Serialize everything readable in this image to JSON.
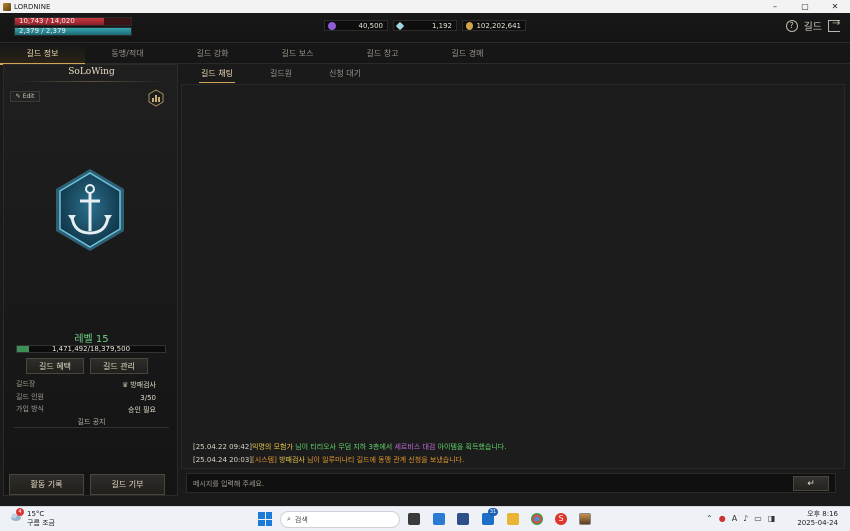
{
  "window": {
    "title": "LORDNINE",
    "min": "–",
    "max": "▢",
    "close": "✕"
  },
  "status": {
    "hp": "10,743 / 14,020",
    "hp_frac": 0.766,
    "mp": "2,379 / 2,379",
    "mp_frac": 1.0
  },
  "currency": [
    {
      "icon": "purple-gem-icon",
      "value": "40,500",
      "color": "#8e5bd6"
    },
    {
      "icon": "diamond-icon",
      "value": "1,192",
      "color": "#9fd6e0"
    },
    {
      "icon": "gold-coin-icon",
      "value": "102,202,641",
      "color": "#d0a24a"
    }
  ],
  "header_right": {
    "help": "?",
    "title": "길드"
  },
  "main_tabs": [
    "길드 정보",
    "동맹/적대",
    "길드 강화",
    "길드 보스",
    "길드 창고",
    "길드 경매"
  ],
  "left": {
    "guild_name": "SoLoWing",
    "edit": "Edit",
    "level": "레벨 15",
    "exp": "1,471,492/18,379,500",
    "exp_frac": 0.08,
    "btn_benefit": "길드 혜택",
    "btn_manage": "길드 관리",
    "rows": [
      {
        "label": "길드장",
        "value": "방패검사"
      },
      {
        "label": "길드 인원",
        "value": "3/50"
      },
      {
        "label": "가입 방식",
        "value": "승인 필요"
      }
    ],
    "notice": "길드 공지",
    "btn_record": "활동 기록",
    "btn_donate": "길드 기부"
  },
  "sub_tabs": [
    "길드 채팅",
    "길드원",
    "신청 대기"
  ],
  "chat": [
    {
      "time": "[25.04.22 09:42]",
      "parts": [
        {
          "t": "익명의 모험가",
          "c": "#e6c84a"
        },
        {
          "t": " 님이 ",
          "c": "#5fd36a"
        },
        {
          "t": "티리오사 무덤 지하 3층",
          "c": "#5fd36a"
        },
        {
          "t": "에서 ",
          "c": "#5fd36a"
        },
        {
          "t": "세르비스 대검",
          "c": "#c06adf"
        },
        {
          "t": " 아이템을 획득했습니다.",
          "c": "#5fd36a"
        }
      ]
    },
    {
      "time": "[25.04.24 20:03]",
      "parts": [
        {
          "t": "[시스템] ",
          "c": "#e0952e"
        },
        {
          "t": "방패검사",
          "c": "#e6c84a"
        },
        {
          "t": " 님이 일루미나티 길드에 동맹 관계 신청을 보냈습니다.",
          "c": "#e0952e"
        }
      ]
    }
  ],
  "input": {
    "placeholder": "메시지를 입력해 주세요.",
    "send": "↵"
  },
  "taskbar": {
    "temp": "15°C",
    "weather": "구름 조금",
    "badge": "4",
    "search": "검색",
    "mail_badge": "31",
    "time": "오후 8:16",
    "date": "2025-04-24",
    "lang": "A"
  }
}
